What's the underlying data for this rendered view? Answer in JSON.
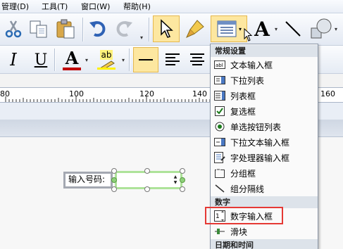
{
  "menubar": {
    "items": [
      {
        "label": "管理(D)"
      },
      {
        "label": "工具(T)"
      },
      {
        "label": "窗口(W)"
      },
      {
        "label": "帮助(H)"
      }
    ]
  },
  "toolbar": {
    "font_a_glyph": "A",
    "italic_glyph": "I",
    "underline_glyph": "U",
    "color_a_glyph": "A",
    "highlight_glyph": "ab"
  },
  "ruler": {
    "ticks": [
      "80",
      "100",
      "120",
      "140",
      "160"
    ]
  },
  "form_control": {
    "label": "输入号码:"
  },
  "dropdown_menu": {
    "sections": [
      {
        "title": "常规设置",
        "items": [
          {
            "label": "文本输入框",
            "icon": "textbox-icon"
          },
          {
            "label": "下拉列表",
            "icon": "dropdown-list-icon"
          },
          {
            "label": "列表框",
            "icon": "listbox-icon"
          },
          {
            "label": "复选框",
            "icon": "checkbox-icon"
          },
          {
            "label": "单选按钮列表",
            "icon": "radio-list-icon"
          },
          {
            "label": "下拉文本输入框",
            "icon": "dropdown-textbox-icon"
          },
          {
            "label": "字处理器输入框",
            "icon": "word-processor-icon"
          },
          {
            "label": "分组框",
            "icon": "groupbox-icon"
          },
          {
            "label": "组分隔线",
            "icon": "group-separator-icon"
          }
        ]
      },
      {
        "title": "数字",
        "items": [
          {
            "label": "数字输入框",
            "icon": "numeric-input-icon"
          },
          {
            "label": "滑块",
            "icon": "slider-icon"
          }
        ]
      },
      {
        "title": "日期和时间",
        "items": []
      }
    ]
  },
  "colors": {
    "highlight_border": "#e53935",
    "selection_green": "#aee39a",
    "toolbar_active": "#fde7a0"
  }
}
